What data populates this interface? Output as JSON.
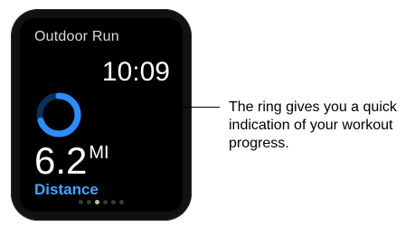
{
  "workout": {
    "title": "Outdoor Run",
    "time": "10:09",
    "distance_value": "6.2",
    "distance_unit": "MI",
    "metric_label": "Distance",
    "progress": 0.7
  },
  "pager": {
    "count": 6,
    "active_index": 2
  },
  "callout": {
    "text": "The ring gives you a quick indication of your workout progress."
  },
  "colors": {
    "ring_fill": "#2f8cff",
    "ring_track": "#0b2e57",
    "accent_label": "#4aa3ff"
  }
}
